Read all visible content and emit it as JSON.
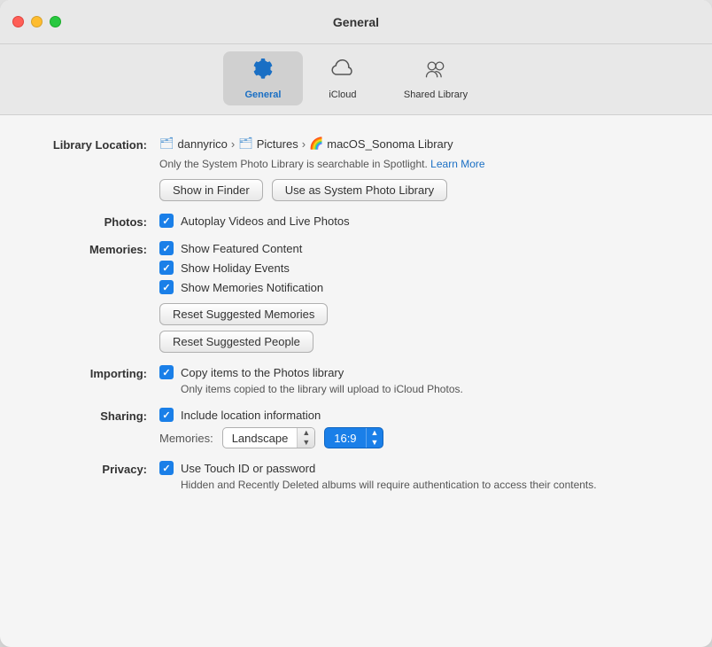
{
  "window": {
    "title": "General"
  },
  "toolbar": {
    "tabs": [
      {
        "id": "general",
        "label": "General",
        "active": true
      },
      {
        "id": "icloud",
        "label": "iCloud",
        "active": false
      },
      {
        "id": "shared-library",
        "label": "Shared Library",
        "active": false
      }
    ]
  },
  "library_location": {
    "label": "Library Location:",
    "path_parts": [
      "dannyrico",
      "Pictures",
      "macOS_Sonoma Library"
    ],
    "note": "Only the System Photo Library is searchable in Spotlight.",
    "learn_more": "Learn More",
    "btn_show_finder": "Show in Finder",
    "btn_use_system": "Use as System Photo Library"
  },
  "photos": {
    "label": "Photos:",
    "autoplay": "Autoplay Videos and Live Photos"
  },
  "memories": {
    "label": "Memories:",
    "show_featured": "Show Featured Content",
    "show_holiday": "Show Holiday Events",
    "show_notification": "Show Memories Notification",
    "btn_reset_memories": "Reset Suggested Memories",
    "btn_reset_people": "Reset Suggested People"
  },
  "importing": {
    "label": "Importing:",
    "copy_items": "Copy items to the Photos library",
    "note": "Only items copied to the library will upload to iCloud Photos."
  },
  "sharing": {
    "label": "Sharing:",
    "include_location": "Include location information",
    "memories_label": "Memories:",
    "orientation": "Landscape",
    "ratio": "16:9"
  },
  "privacy": {
    "label": "Privacy:",
    "touch_id": "Use Touch ID or password",
    "note": "Hidden and Recently Deleted albums will require authentication to access their contents."
  }
}
